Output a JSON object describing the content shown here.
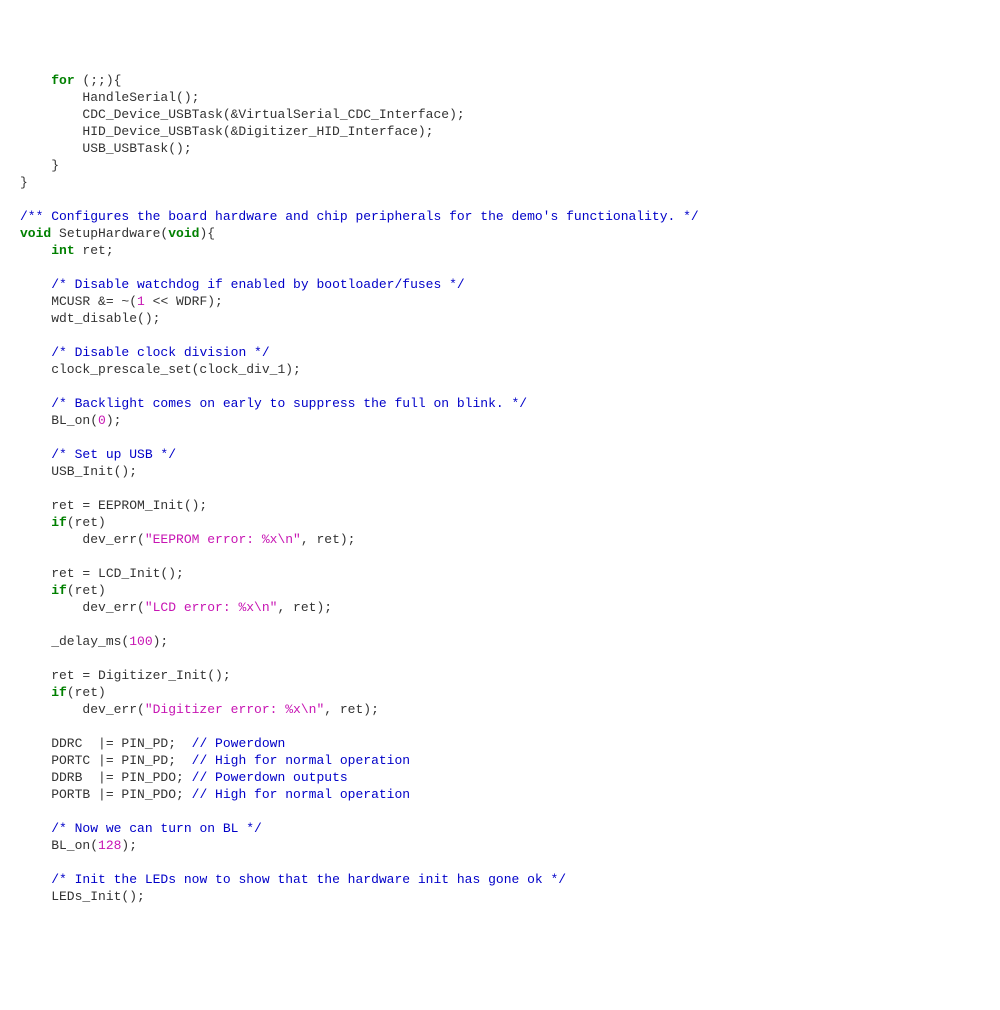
{
  "code": {
    "lines": [
      [
        {
          "cls": "plain",
          "txt": "    "
        },
        {
          "cls": "kw",
          "txt": "for"
        },
        {
          "cls": "plain",
          "txt": " (;;){"
        }
      ],
      [
        {
          "cls": "plain",
          "txt": "        HandleSerial();"
        }
      ],
      [
        {
          "cls": "plain",
          "txt": "        CDC_Device_USBTask(&VirtualSerial_CDC_Interface);"
        }
      ],
      [
        {
          "cls": "plain",
          "txt": "        HID_Device_USBTask(&Digitizer_HID_Interface);"
        }
      ],
      [
        {
          "cls": "plain",
          "txt": "        USB_USBTask();"
        }
      ],
      [
        {
          "cls": "plain",
          "txt": "    }"
        }
      ],
      [
        {
          "cls": "plain",
          "txt": "}"
        }
      ],
      [
        {
          "cls": "plain",
          "txt": ""
        }
      ],
      [
        {
          "cls": "com",
          "txt": "/** Configures the board hardware and chip peripherals for the demo's functionality. */"
        }
      ],
      [
        {
          "cls": "kw",
          "txt": "void"
        },
        {
          "cls": "plain",
          "txt": " SetupHardware("
        },
        {
          "cls": "kw",
          "txt": "void"
        },
        {
          "cls": "plain",
          "txt": "){"
        }
      ],
      [
        {
          "cls": "plain",
          "txt": "    "
        },
        {
          "cls": "kw",
          "txt": "int"
        },
        {
          "cls": "plain",
          "txt": " ret;"
        }
      ],
      [
        {
          "cls": "plain",
          "txt": ""
        }
      ],
      [
        {
          "cls": "plain",
          "txt": "    "
        },
        {
          "cls": "com",
          "txt": "/* Disable watchdog if enabled by bootloader/fuses */"
        }
      ],
      [
        {
          "cls": "plain",
          "txt": "    MCUSR &= ~("
        },
        {
          "cls": "num",
          "txt": "1"
        },
        {
          "cls": "plain",
          "txt": " << WDRF);"
        }
      ],
      [
        {
          "cls": "plain",
          "txt": "    wdt_disable();"
        }
      ],
      [
        {
          "cls": "plain",
          "txt": ""
        }
      ],
      [
        {
          "cls": "plain",
          "txt": "    "
        },
        {
          "cls": "com",
          "txt": "/* Disable clock division */"
        }
      ],
      [
        {
          "cls": "plain",
          "txt": "    clock_prescale_set(clock_div_1);"
        }
      ],
      [
        {
          "cls": "plain",
          "txt": ""
        }
      ],
      [
        {
          "cls": "plain",
          "txt": "    "
        },
        {
          "cls": "com",
          "txt": "/* Backlight comes on early to suppress the full on blink. */"
        }
      ],
      [
        {
          "cls": "plain",
          "txt": "    BL_on("
        },
        {
          "cls": "num",
          "txt": "0"
        },
        {
          "cls": "plain",
          "txt": ");"
        }
      ],
      [
        {
          "cls": "plain",
          "txt": ""
        }
      ],
      [
        {
          "cls": "plain",
          "txt": "    "
        },
        {
          "cls": "com",
          "txt": "/* Set up USB */"
        }
      ],
      [
        {
          "cls": "plain",
          "txt": "    USB_Init();"
        }
      ],
      [
        {
          "cls": "plain",
          "txt": ""
        }
      ],
      [
        {
          "cls": "plain",
          "txt": "    ret = EEPROM_Init();"
        }
      ],
      [
        {
          "cls": "plain",
          "txt": "    "
        },
        {
          "cls": "kw",
          "txt": "if"
        },
        {
          "cls": "plain",
          "txt": "(ret)"
        }
      ],
      [
        {
          "cls": "plain",
          "txt": "        dev_err("
        },
        {
          "cls": "str",
          "txt": "\"EEPROM error: %x\\n\""
        },
        {
          "cls": "plain",
          "txt": ", ret);"
        }
      ],
      [
        {
          "cls": "plain",
          "txt": ""
        }
      ],
      [
        {
          "cls": "plain",
          "txt": "    ret = LCD_Init();"
        }
      ],
      [
        {
          "cls": "plain",
          "txt": "    "
        },
        {
          "cls": "kw",
          "txt": "if"
        },
        {
          "cls": "plain",
          "txt": "(ret)"
        }
      ],
      [
        {
          "cls": "plain",
          "txt": "        dev_err("
        },
        {
          "cls": "str",
          "txt": "\"LCD error: %x\\n\""
        },
        {
          "cls": "plain",
          "txt": ", ret);"
        }
      ],
      [
        {
          "cls": "plain",
          "txt": ""
        }
      ],
      [
        {
          "cls": "plain",
          "txt": "    _delay_ms("
        },
        {
          "cls": "num",
          "txt": "100"
        },
        {
          "cls": "plain",
          "txt": ");"
        }
      ],
      [
        {
          "cls": "plain",
          "txt": ""
        }
      ],
      [
        {
          "cls": "plain",
          "txt": "    ret = Digitizer_Init();"
        }
      ],
      [
        {
          "cls": "plain",
          "txt": "    "
        },
        {
          "cls": "kw",
          "txt": "if"
        },
        {
          "cls": "plain",
          "txt": "(ret)"
        }
      ],
      [
        {
          "cls": "plain",
          "txt": "        dev_err("
        },
        {
          "cls": "str",
          "txt": "\"Digitizer error: %x\\n\""
        },
        {
          "cls": "plain",
          "txt": ", ret);"
        }
      ],
      [
        {
          "cls": "plain",
          "txt": ""
        }
      ],
      [
        {
          "cls": "plain",
          "txt": "    DDRC  |= PIN_PD;  "
        },
        {
          "cls": "com",
          "txt": "// Powerdown"
        }
      ],
      [
        {
          "cls": "plain",
          "txt": "    PORTC |= PIN_PD;  "
        },
        {
          "cls": "com",
          "txt": "// High for normal operation"
        }
      ],
      [
        {
          "cls": "plain",
          "txt": "    DDRB  |= PIN_PDO; "
        },
        {
          "cls": "com",
          "txt": "// Powerdown outputs"
        }
      ],
      [
        {
          "cls": "plain",
          "txt": "    PORTB |= PIN_PDO; "
        },
        {
          "cls": "com",
          "txt": "// High for normal operation"
        }
      ],
      [
        {
          "cls": "plain",
          "txt": ""
        }
      ],
      [
        {
          "cls": "plain",
          "txt": "    "
        },
        {
          "cls": "com",
          "txt": "/* Now we can turn on BL */"
        }
      ],
      [
        {
          "cls": "plain",
          "txt": "    BL_on("
        },
        {
          "cls": "num",
          "txt": "128"
        },
        {
          "cls": "plain",
          "txt": ");"
        }
      ],
      [
        {
          "cls": "plain",
          "txt": ""
        }
      ],
      [
        {
          "cls": "plain",
          "txt": "    "
        },
        {
          "cls": "com",
          "txt": "/* Init the LEDs now to show that the hardware init has gone ok */"
        }
      ],
      [
        {
          "cls": "plain",
          "txt": "    LEDs_Init();"
        }
      ]
    ]
  }
}
